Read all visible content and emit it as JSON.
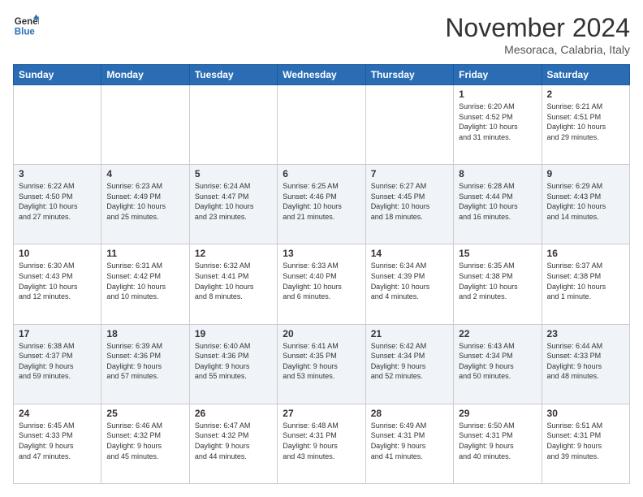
{
  "header": {
    "logo_line1": "General",
    "logo_line2": "Blue",
    "month": "November 2024",
    "location": "Mesoraca, Calabria, Italy"
  },
  "weekdays": [
    "Sunday",
    "Monday",
    "Tuesday",
    "Wednesday",
    "Thursday",
    "Friday",
    "Saturday"
  ],
  "weeks": [
    [
      {
        "day": "",
        "info": ""
      },
      {
        "day": "",
        "info": ""
      },
      {
        "day": "",
        "info": ""
      },
      {
        "day": "",
        "info": ""
      },
      {
        "day": "",
        "info": ""
      },
      {
        "day": "1",
        "info": "Sunrise: 6:20 AM\nSunset: 4:52 PM\nDaylight: 10 hours\nand 31 minutes."
      },
      {
        "day": "2",
        "info": "Sunrise: 6:21 AM\nSunset: 4:51 PM\nDaylight: 10 hours\nand 29 minutes."
      }
    ],
    [
      {
        "day": "3",
        "info": "Sunrise: 6:22 AM\nSunset: 4:50 PM\nDaylight: 10 hours\nand 27 minutes."
      },
      {
        "day": "4",
        "info": "Sunrise: 6:23 AM\nSunset: 4:49 PM\nDaylight: 10 hours\nand 25 minutes."
      },
      {
        "day": "5",
        "info": "Sunrise: 6:24 AM\nSunset: 4:47 PM\nDaylight: 10 hours\nand 23 minutes."
      },
      {
        "day": "6",
        "info": "Sunrise: 6:25 AM\nSunset: 4:46 PM\nDaylight: 10 hours\nand 21 minutes."
      },
      {
        "day": "7",
        "info": "Sunrise: 6:27 AM\nSunset: 4:45 PM\nDaylight: 10 hours\nand 18 minutes."
      },
      {
        "day": "8",
        "info": "Sunrise: 6:28 AM\nSunset: 4:44 PM\nDaylight: 10 hours\nand 16 minutes."
      },
      {
        "day": "9",
        "info": "Sunrise: 6:29 AM\nSunset: 4:43 PM\nDaylight: 10 hours\nand 14 minutes."
      }
    ],
    [
      {
        "day": "10",
        "info": "Sunrise: 6:30 AM\nSunset: 4:43 PM\nDaylight: 10 hours\nand 12 minutes."
      },
      {
        "day": "11",
        "info": "Sunrise: 6:31 AM\nSunset: 4:42 PM\nDaylight: 10 hours\nand 10 minutes."
      },
      {
        "day": "12",
        "info": "Sunrise: 6:32 AM\nSunset: 4:41 PM\nDaylight: 10 hours\nand 8 minutes."
      },
      {
        "day": "13",
        "info": "Sunrise: 6:33 AM\nSunset: 4:40 PM\nDaylight: 10 hours\nand 6 minutes."
      },
      {
        "day": "14",
        "info": "Sunrise: 6:34 AM\nSunset: 4:39 PM\nDaylight: 10 hours\nand 4 minutes."
      },
      {
        "day": "15",
        "info": "Sunrise: 6:35 AM\nSunset: 4:38 PM\nDaylight: 10 hours\nand 2 minutes."
      },
      {
        "day": "16",
        "info": "Sunrise: 6:37 AM\nSunset: 4:38 PM\nDaylight: 10 hours\nand 1 minute."
      }
    ],
    [
      {
        "day": "17",
        "info": "Sunrise: 6:38 AM\nSunset: 4:37 PM\nDaylight: 9 hours\nand 59 minutes."
      },
      {
        "day": "18",
        "info": "Sunrise: 6:39 AM\nSunset: 4:36 PM\nDaylight: 9 hours\nand 57 minutes."
      },
      {
        "day": "19",
        "info": "Sunrise: 6:40 AM\nSunset: 4:36 PM\nDaylight: 9 hours\nand 55 minutes."
      },
      {
        "day": "20",
        "info": "Sunrise: 6:41 AM\nSunset: 4:35 PM\nDaylight: 9 hours\nand 53 minutes."
      },
      {
        "day": "21",
        "info": "Sunrise: 6:42 AM\nSunset: 4:34 PM\nDaylight: 9 hours\nand 52 minutes."
      },
      {
        "day": "22",
        "info": "Sunrise: 6:43 AM\nSunset: 4:34 PM\nDaylight: 9 hours\nand 50 minutes."
      },
      {
        "day": "23",
        "info": "Sunrise: 6:44 AM\nSunset: 4:33 PM\nDaylight: 9 hours\nand 48 minutes."
      }
    ],
    [
      {
        "day": "24",
        "info": "Sunrise: 6:45 AM\nSunset: 4:33 PM\nDaylight: 9 hours\nand 47 minutes."
      },
      {
        "day": "25",
        "info": "Sunrise: 6:46 AM\nSunset: 4:32 PM\nDaylight: 9 hours\nand 45 minutes."
      },
      {
        "day": "26",
        "info": "Sunrise: 6:47 AM\nSunset: 4:32 PM\nDaylight: 9 hours\nand 44 minutes."
      },
      {
        "day": "27",
        "info": "Sunrise: 6:48 AM\nSunset: 4:31 PM\nDaylight: 9 hours\nand 43 minutes."
      },
      {
        "day": "28",
        "info": "Sunrise: 6:49 AM\nSunset: 4:31 PM\nDaylight: 9 hours\nand 41 minutes."
      },
      {
        "day": "29",
        "info": "Sunrise: 6:50 AM\nSunset: 4:31 PM\nDaylight: 9 hours\nand 40 minutes."
      },
      {
        "day": "30",
        "info": "Sunrise: 6:51 AM\nSunset: 4:31 PM\nDaylight: 9 hours\nand 39 minutes."
      }
    ]
  ]
}
